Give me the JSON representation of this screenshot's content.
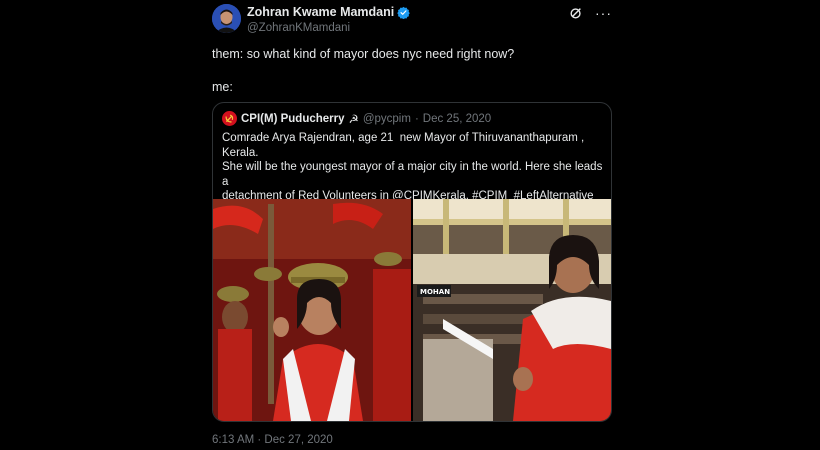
{
  "author": {
    "name": "Zohran Kwame Mamdani",
    "handle": "@ZohranKMamdani",
    "verified": true
  },
  "tweet": {
    "line1": "them: so what kind of mayor does nyc need right now?",
    "line2": "me:",
    "timestamp": "6:13 AM · Dec 27, 2020"
  },
  "quoted": {
    "name": "CPI(M) Puducherry",
    "emoji": "☭",
    "handle": "@pycpim",
    "date": "Dec 25, 2020",
    "text": "Comrade Arya Rajendran, age 21  new Mayor of Thiruvananthapuram , Kerala.\nShe will be the youngest mayor of a major city in the world. Here she leads a\ndetachment of Red Volunteers in @CPIMKerala. #CPIM  #LeftAlternative\n#Communist",
    "photo2_sign": "MOHAN"
  },
  "icons": {
    "verified": "verified-badge-icon",
    "grok": "grok-icon",
    "more": "more-options-icon",
    "quoted_avatar": "hammer-sickle-icon"
  },
  "colors": {
    "background": "#000000",
    "text": "#e7e9ea",
    "secondary": "#71767b",
    "border": "#2f3336",
    "verified": "#1d9bf0",
    "party_red": "#d2101e"
  }
}
